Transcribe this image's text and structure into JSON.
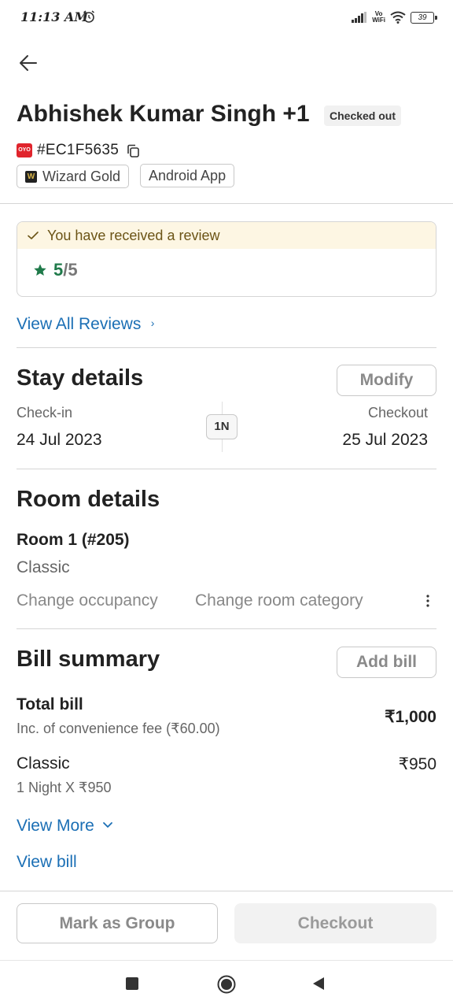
{
  "status_bar": {
    "time": "11:13 AM",
    "vowifi_line1": "Vo",
    "vowifi_line2": "WiFi",
    "battery": "39"
  },
  "header": {
    "guest_name": "Abhishek Kumar Singh +1",
    "status": "Checked out",
    "brand_logo": "OYO",
    "booking_id": "#EC1F5635",
    "tags": [
      "Wizard Gold",
      "Android App"
    ],
    "wizard_logo": "W"
  },
  "review": {
    "banner": "You have received a review",
    "score": "5",
    "out_of": "/5",
    "view_all": "View All Reviews"
  },
  "stay": {
    "title": "Stay details",
    "modify_label": "Modify",
    "checkin_label": "Check-in",
    "checkin_date": "24 Jul 2023",
    "checkout_label": "Checkout",
    "checkout_date": "25 Jul 2023",
    "nights": "1N"
  },
  "room": {
    "title": "Room details",
    "name": "Room 1 (#205)",
    "category": "Classic",
    "change_occupancy": "Change occupancy",
    "change_category": "Change room category"
  },
  "bill": {
    "title": "Bill summary",
    "add_bill_label": "Add bill",
    "total_label": "Total bill",
    "total_note": "Inc. of convenience fee (₹60.00)",
    "total_amount": "₹1,000",
    "item_label": "Classic",
    "item_detail": "1 Night X ₹950",
    "item_amount": "₹950",
    "view_more": "View More",
    "view_bill": "View bill"
  },
  "actions": {
    "mark_group": "Mark as Group",
    "checkout": "Checkout"
  },
  "colors": {
    "accent_link": "#1b6fb5",
    "review_green": "#1f7a4a",
    "banner_bg": "#fdf6e3",
    "brand_red": "#e0242c"
  }
}
